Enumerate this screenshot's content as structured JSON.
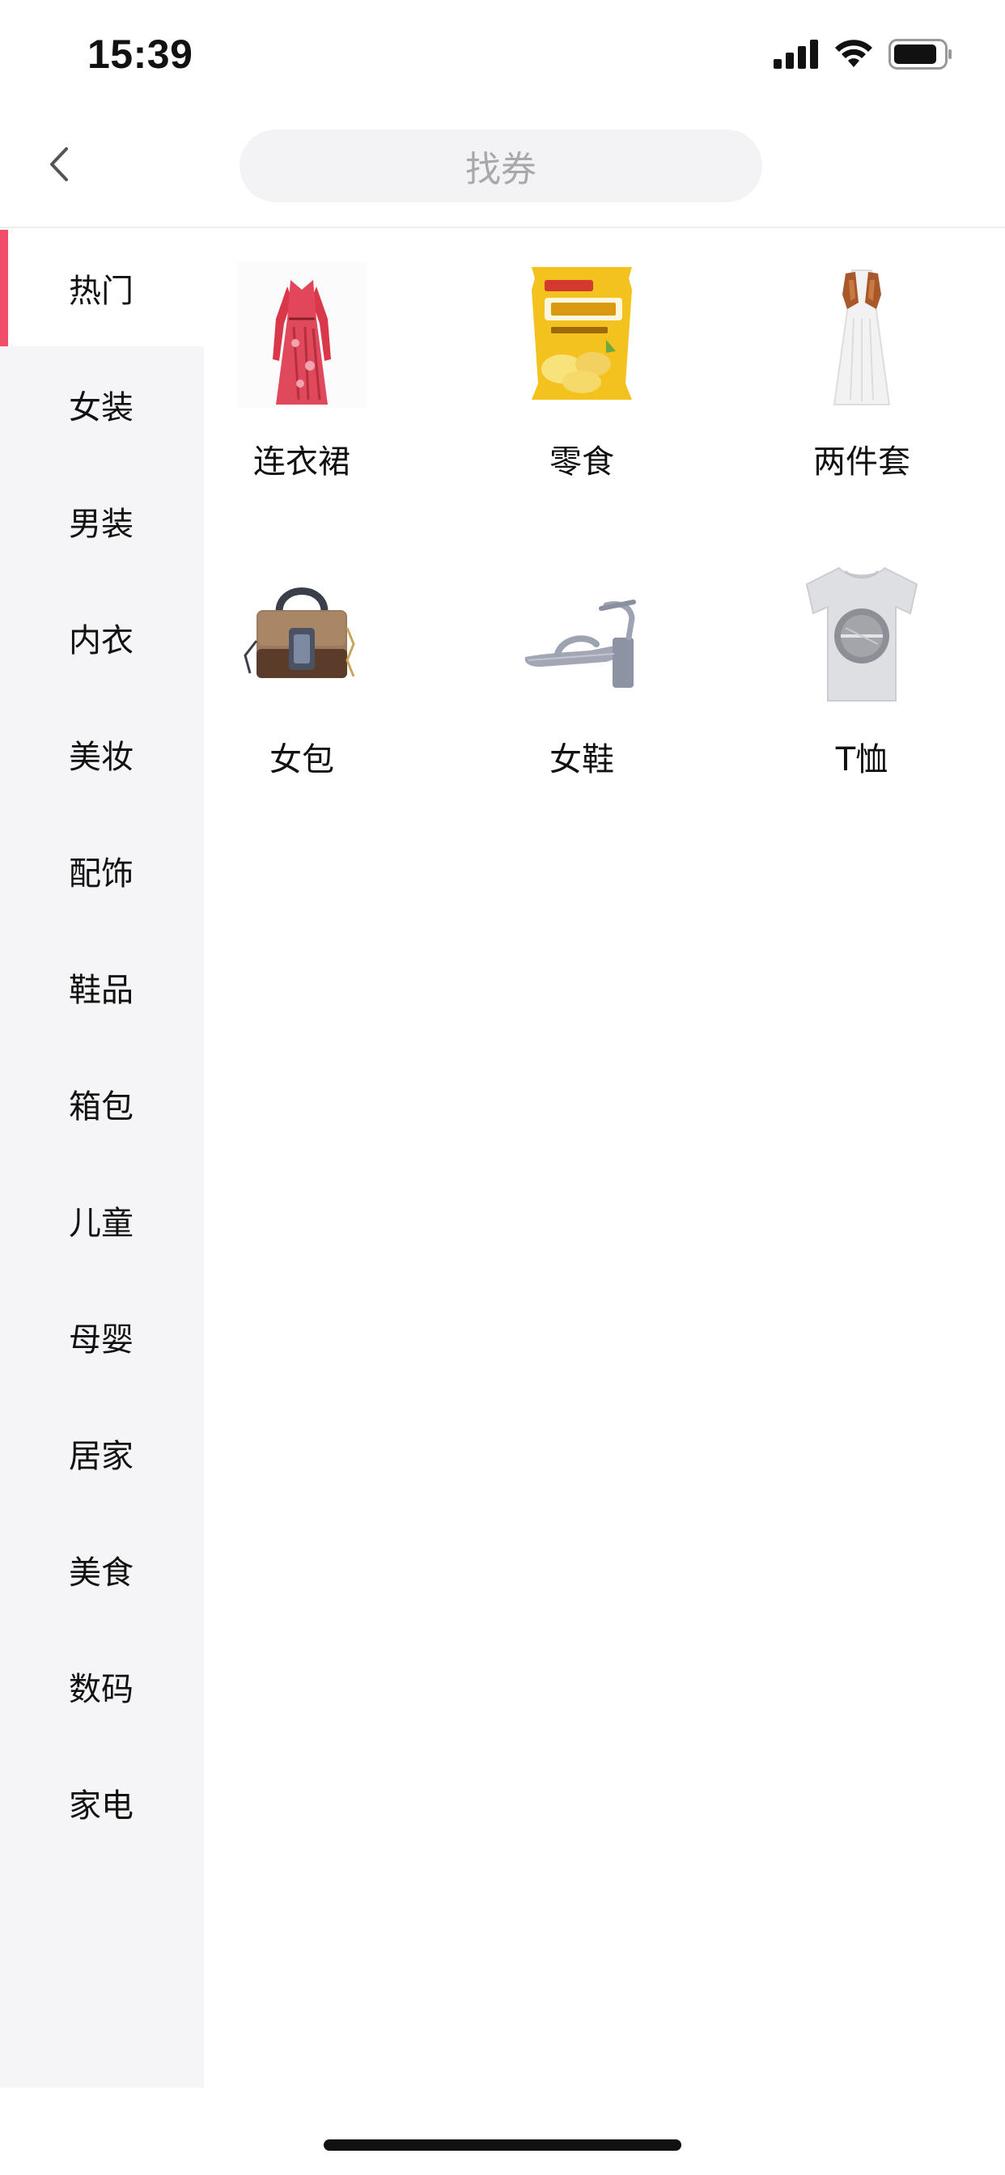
{
  "status_bar": {
    "time": "15:39",
    "icons": [
      "cellular-signal-icon",
      "wifi-icon",
      "battery-icon"
    ]
  },
  "nav": {
    "back_icon": "chevron-left-icon",
    "search_placeholder": "找券"
  },
  "sidebar": {
    "active_color": "#ef4d6a",
    "items": [
      {
        "label": "热门",
        "active": true
      },
      {
        "label": "女装"
      },
      {
        "label": "男装"
      },
      {
        "label": "内衣"
      },
      {
        "label": "美妆"
      },
      {
        "label": "配饰"
      },
      {
        "label": "鞋品"
      },
      {
        "label": "箱包"
      },
      {
        "label": "儿童"
      },
      {
        "label": "母婴"
      },
      {
        "label": "居家"
      },
      {
        "label": "美食"
      },
      {
        "label": "数码"
      },
      {
        "label": "家电"
      }
    ]
  },
  "categories": [
    {
      "label": "连衣裙",
      "icon": "dress-icon"
    },
    {
      "label": "零食",
      "icon": "snack-bag-icon"
    },
    {
      "label": "两件套",
      "icon": "two-piece-outfit-icon"
    },
    {
      "label": "女包",
      "icon": "handbag-icon"
    },
    {
      "label": "女鞋",
      "icon": "sandal-icon"
    },
    {
      "label": "T恤",
      "icon": "tshirt-icon"
    }
  ]
}
